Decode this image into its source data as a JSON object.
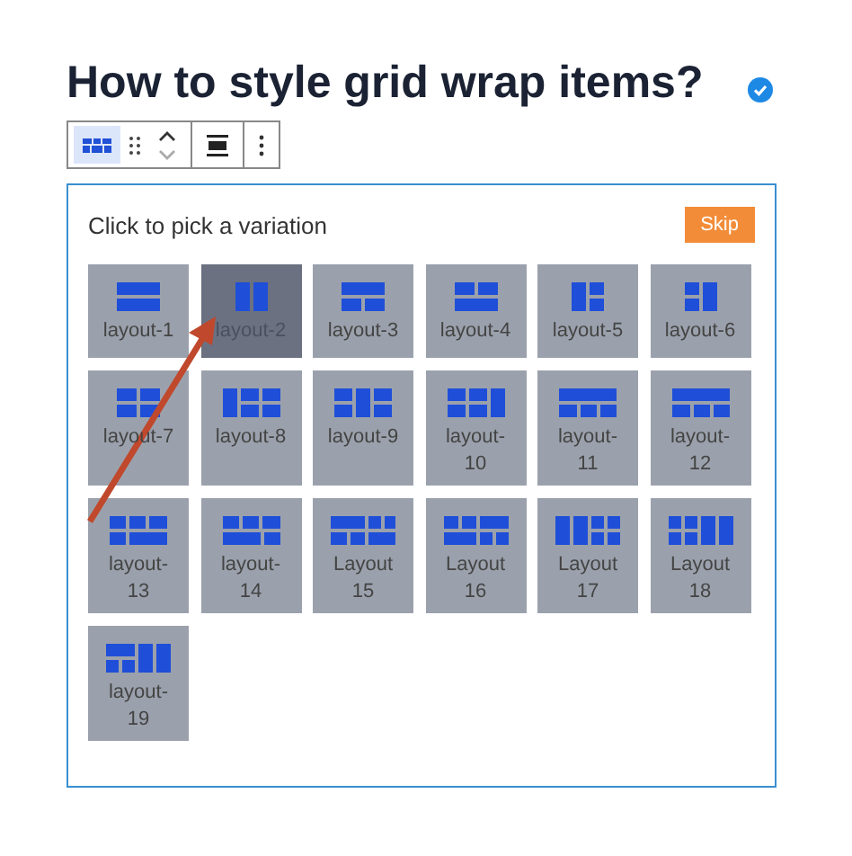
{
  "heading": "How to style grid wrap items?",
  "toolbar": {
    "buttons": [
      {
        "kind": "block-type",
        "selected": true
      },
      {
        "kind": "drag"
      },
      {
        "kind": "move"
      },
      {
        "kind": "align"
      },
      {
        "kind": "more"
      }
    ]
  },
  "placeholder": {
    "instruction": "Click to pick a variation",
    "skip_button": "Skip",
    "variations": [
      {
        "label": "layout-1",
        "selected": false
      },
      {
        "label": "layout-2",
        "selected": true
      },
      {
        "label": "layout-3",
        "selected": false
      },
      {
        "label": "layout-4",
        "selected": false
      },
      {
        "label": "layout-5",
        "selected": false
      },
      {
        "label": "layout-6",
        "selected": false
      },
      {
        "label": "layout-7",
        "selected": false
      },
      {
        "label": "layout-8",
        "selected": false
      },
      {
        "label": "layout-9",
        "selected": false
      },
      {
        "label": "layout-10",
        "selected": false
      },
      {
        "label": "layout-11",
        "selected": false
      },
      {
        "label": "layout-12",
        "selected": false
      },
      {
        "label": "layout-13",
        "selected": false
      },
      {
        "label": "layout-14",
        "selected": false
      },
      {
        "label": "Layout 15",
        "selected": false
      },
      {
        "label": "Layout 16",
        "selected": false
      },
      {
        "label": "Layout 17",
        "selected": false
      },
      {
        "label": "Layout 18",
        "selected": false
      },
      {
        "label": "layout-19",
        "selected": false
      }
    ]
  }
}
